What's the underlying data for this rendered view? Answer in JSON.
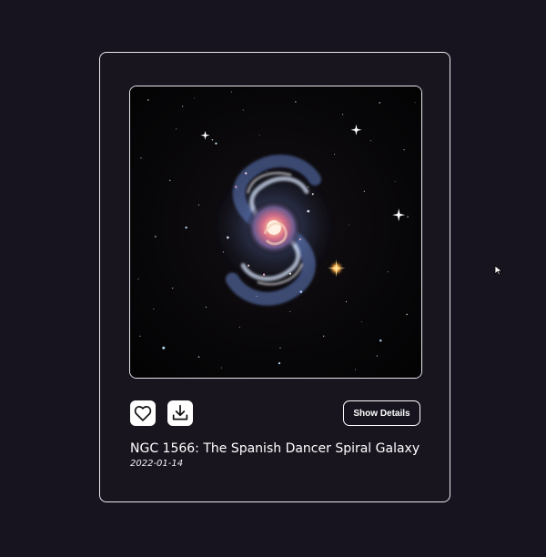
{
  "app": {
    "background_color": "#17141f",
    "card_border_color": "#e9e9ee"
  },
  "media": {
    "image_alt": "NGC 1566: The Spanish Dancer Spiral Galaxy"
  },
  "actions": {
    "like_icon": "heart-icon",
    "download_icon": "download-icon",
    "details_label": "Show Details"
  },
  "post": {
    "title": "NGC 1566: The Spanish Dancer Spiral Galaxy",
    "date": "2022-01-14"
  }
}
